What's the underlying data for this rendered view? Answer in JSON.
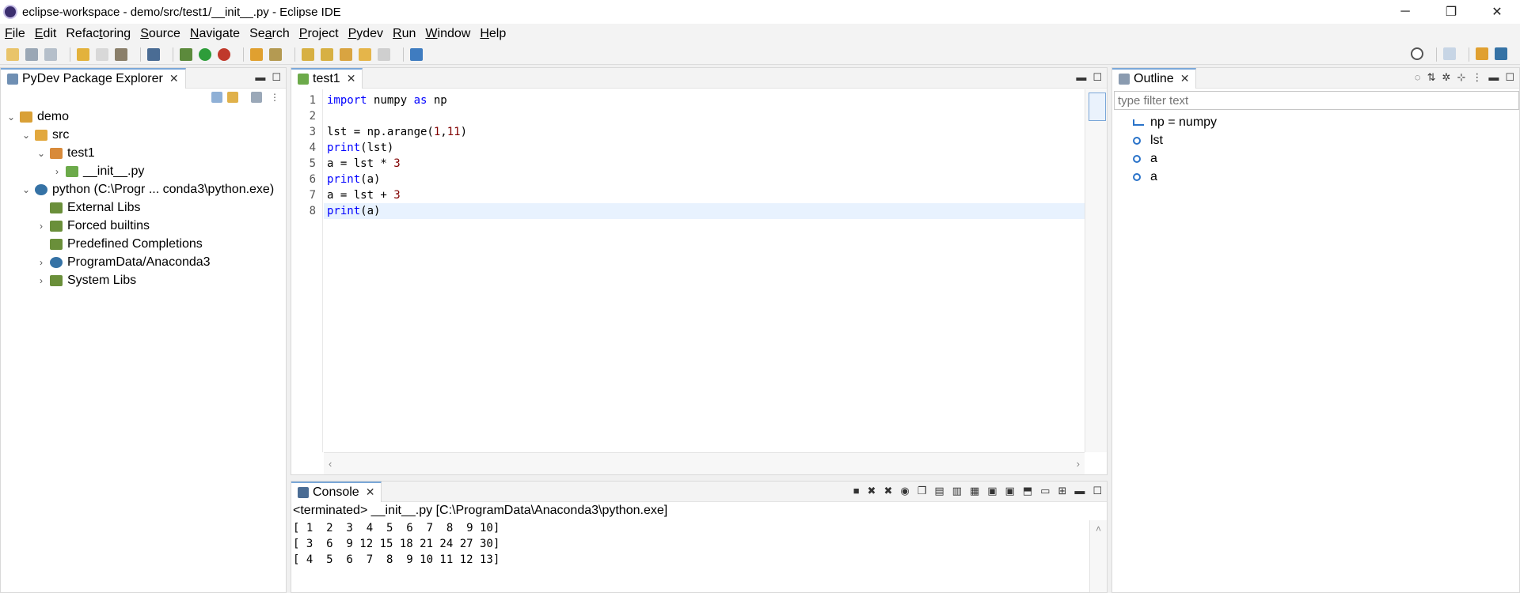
{
  "window": {
    "title": "eclipse-workspace - demo/src/test1/__init__.py - Eclipse IDE",
    "controls": [
      "─",
      "❐",
      "✕"
    ]
  },
  "menu": {
    "items": [
      {
        "first": "F",
        "rest": "ile"
      },
      {
        "first": "E",
        "rest": "dit"
      },
      {
        "pre": "Refac",
        "first": "t",
        "rest": "oring"
      },
      {
        "first": "S",
        "rest": "ource"
      },
      {
        "first": "N",
        "rest": "avigate"
      },
      {
        "pre": "Se",
        "first": "a",
        "rest": "rch"
      },
      {
        "first": "P",
        "rest": "roject"
      },
      {
        "first": "P",
        "rest": "ydev"
      },
      {
        "first": "R",
        "rest": "un"
      },
      {
        "first": "W",
        "rest": "indow"
      },
      {
        "first": "H",
        "rest": "elp"
      }
    ]
  },
  "explorer": {
    "tab_label": "PyDev Package Explorer",
    "tree": [
      {
        "label": "demo",
        "twisty": "⌄"
      },
      {
        "label": "src",
        "twisty": "⌄"
      },
      {
        "label": "test1",
        "twisty": "⌄"
      },
      {
        "label": "__init__.py",
        "twisty": "›"
      },
      {
        "label": "python  (C:\\Progr ... conda3\\python.exe)",
        "twisty": "⌄"
      },
      {
        "label": "External Libs",
        "twisty": ""
      },
      {
        "label": "Forced builtins",
        "twisty": "›"
      },
      {
        "label": "Predefined Completions",
        "twisty": ""
      },
      {
        "label": "ProgramData/Anaconda3",
        "twisty": "›"
      },
      {
        "label": "System Libs",
        "twisty": "›"
      }
    ]
  },
  "editor": {
    "tab_label": "test1",
    "line_numbers": [
      "1",
      "2",
      "3",
      "4",
      "5",
      "6",
      "7",
      "8"
    ],
    "code": {
      "l1": {
        "kw1": "import",
        "t1": " numpy ",
        "kw2": "as",
        "t2": " np"
      },
      "l3": {
        "t1": "lst = np.arange(",
        "n1": "1",
        "t2": ",",
        "n2": "11",
        "t3": ")"
      },
      "l4": {
        "kw1": "print",
        "t1": "(lst)"
      },
      "l5": {
        "t1": "a = lst * ",
        "n1": "3"
      },
      "l6": {
        "kw1": "print",
        "t1": "(a)"
      },
      "l7": {
        "t1": "a = lst + ",
        "n1": "3"
      },
      "l8": {
        "kw1": "print",
        "t1": "(a)"
      }
    }
  },
  "outline": {
    "tab_label": "Outline",
    "filter_placeholder": "type filter text",
    "items": [
      "np = numpy",
      "lst",
      "a",
      "a"
    ]
  },
  "console": {
    "tab_label": "Console",
    "status": "<terminated> __init__.py [C:\\ProgramData\\Anaconda3\\python.exe]",
    "output": [
      "[ 1  2  3  4  5  6  7  8  9 10]",
      "[ 3  6  9 12 15 18 21 24 27 30]",
      "[ 4  5  6  7  8  9 10 11 12 13]"
    ]
  },
  "colors": {
    "keyword": "#0000ff",
    "number": "#800000",
    "current_line": "#e8f2fe",
    "active_tab_accent": "#7aa7d8"
  }
}
